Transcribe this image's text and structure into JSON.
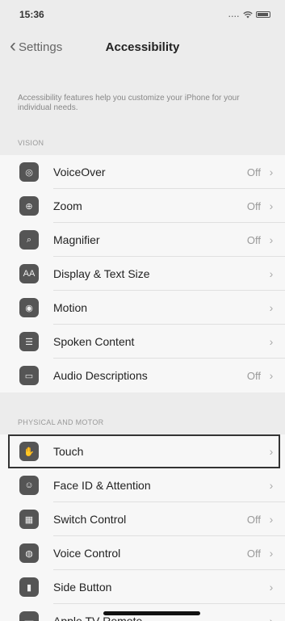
{
  "status": {
    "time": "15:36",
    "signal": "....",
    "wifi": "wifi-icon",
    "battery": "battery-icon"
  },
  "nav": {
    "back_label": "Settings",
    "title": "Accessibility"
  },
  "description": "Accessibility features help you customize your iPhone for your individual needs.",
  "sections": {
    "vision": {
      "header": "VISION",
      "items": [
        {
          "label": "VoiceOver",
          "value": "Off",
          "icon": "voiceover-icon",
          "glyph": "◎"
        },
        {
          "label": "Zoom",
          "value": "Off",
          "icon": "zoom-icon",
          "glyph": "⊕"
        },
        {
          "label": "Magnifier",
          "value": "Off",
          "icon": "magnifier-icon",
          "glyph": "⌕"
        },
        {
          "label": "Display & Text Size",
          "value": "",
          "icon": "display-text-size-icon",
          "glyph": "AA"
        },
        {
          "label": "Motion",
          "value": "",
          "icon": "motion-icon",
          "glyph": "◉"
        },
        {
          "label": "Spoken Content",
          "value": "",
          "icon": "spoken-content-icon",
          "glyph": "☰"
        },
        {
          "label": "Audio Descriptions",
          "value": "Off",
          "icon": "audio-descriptions-icon",
          "glyph": "▭"
        }
      ]
    },
    "physical": {
      "header": "PHYSICAL AND MOTOR",
      "items": [
        {
          "label": "Touch",
          "value": "",
          "icon": "touch-icon",
          "glyph": "✋"
        },
        {
          "label": "Face ID & Attention",
          "value": "",
          "icon": "face-id-icon",
          "glyph": "☺"
        },
        {
          "label": "Switch Control",
          "value": "Off",
          "icon": "switch-control-icon",
          "glyph": "▦"
        },
        {
          "label": "Voice Control",
          "value": "Off",
          "icon": "voice-control-icon",
          "glyph": "◍"
        },
        {
          "label": "Side Button",
          "value": "",
          "icon": "side-button-icon",
          "glyph": "▮"
        },
        {
          "label": "Apple TV Remote",
          "value": "",
          "icon": "apple-tv-remote-icon",
          "glyph": "▬"
        }
      ]
    }
  },
  "colors": {
    "background": "#ececec",
    "cell": "#f7f7f7",
    "icon": "#555555",
    "highlight_border": "#333333"
  }
}
